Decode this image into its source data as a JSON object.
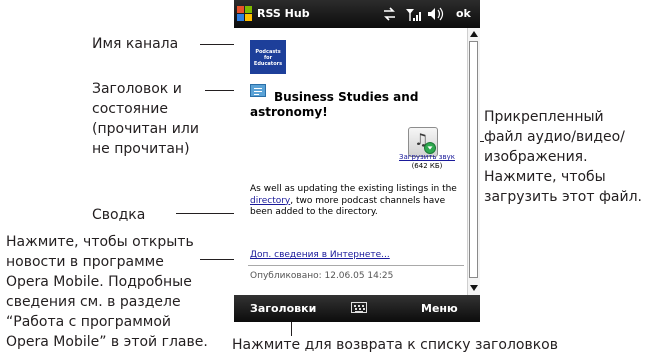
{
  "annotations": {
    "channel_name": "Имя канала",
    "title_status": [
      "Заголовок и",
      "состояние",
      "(прочитан или",
      "не прочитан)"
    ],
    "attachment": [
      "Прикрепленный",
      "файл аудио/видео/",
      "изображения.",
      "Нажмите, чтобы",
      "загрузить этот файл."
    ],
    "summary": "Сводка",
    "open_in_browser": [
      "Нажмите, чтобы открыть",
      "новости в программе",
      "Opera Mobile. Подробные",
      "сведения см. в разделе",
      "“Работа с программой",
      "Opera Mobile” в этой главе."
    ],
    "back_to_headlines": "Нажмите для возврата к списку заголовков"
  },
  "device": {
    "title_bar": {
      "app_title": "RSS Hub",
      "ok_label": "ok"
    },
    "channel": {
      "logo_text": [
        "Podcasts",
        "for",
        "Educators"
      ]
    },
    "item": {
      "title": "Business Studies and astronomy!",
      "download_label": "Загрузить звук",
      "file_size": "(642 КБ)",
      "summary_before": "As well as updating the existing listings in the ",
      "summary_link": "directory",
      "summary_after": ", two more podcast channels have been added to the directory.",
      "more_info_link": "Доп. сведения в Интернете...",
      "published": "Опубликовано: 12.06.05 14:25"
    },
    "soft_keys": {
      "left": "Заголовки",
      "right": "Меню"
    }
  },
  "colors": {
    "bar": "#111111",
    "link": "#1a1a9a",
    "logo_bg": "#1d3f9a",
    "feed_icon": "#5aa2d6",
    "download_badge": "#2fa84f"
  },
  "icons": [
    "windows-logo-icon",
    "sync-icon",
    "signal-icon",
    "volume-icon",
    "podcast-channel-logo",
    "feed-item-icon",
    "music-note-icon",
    "download-arrow-icon",
    "keyboard-icon",
    "scroll-up-arrow-icon",
    "scroll-down-arrow-icon"
  ]
}
